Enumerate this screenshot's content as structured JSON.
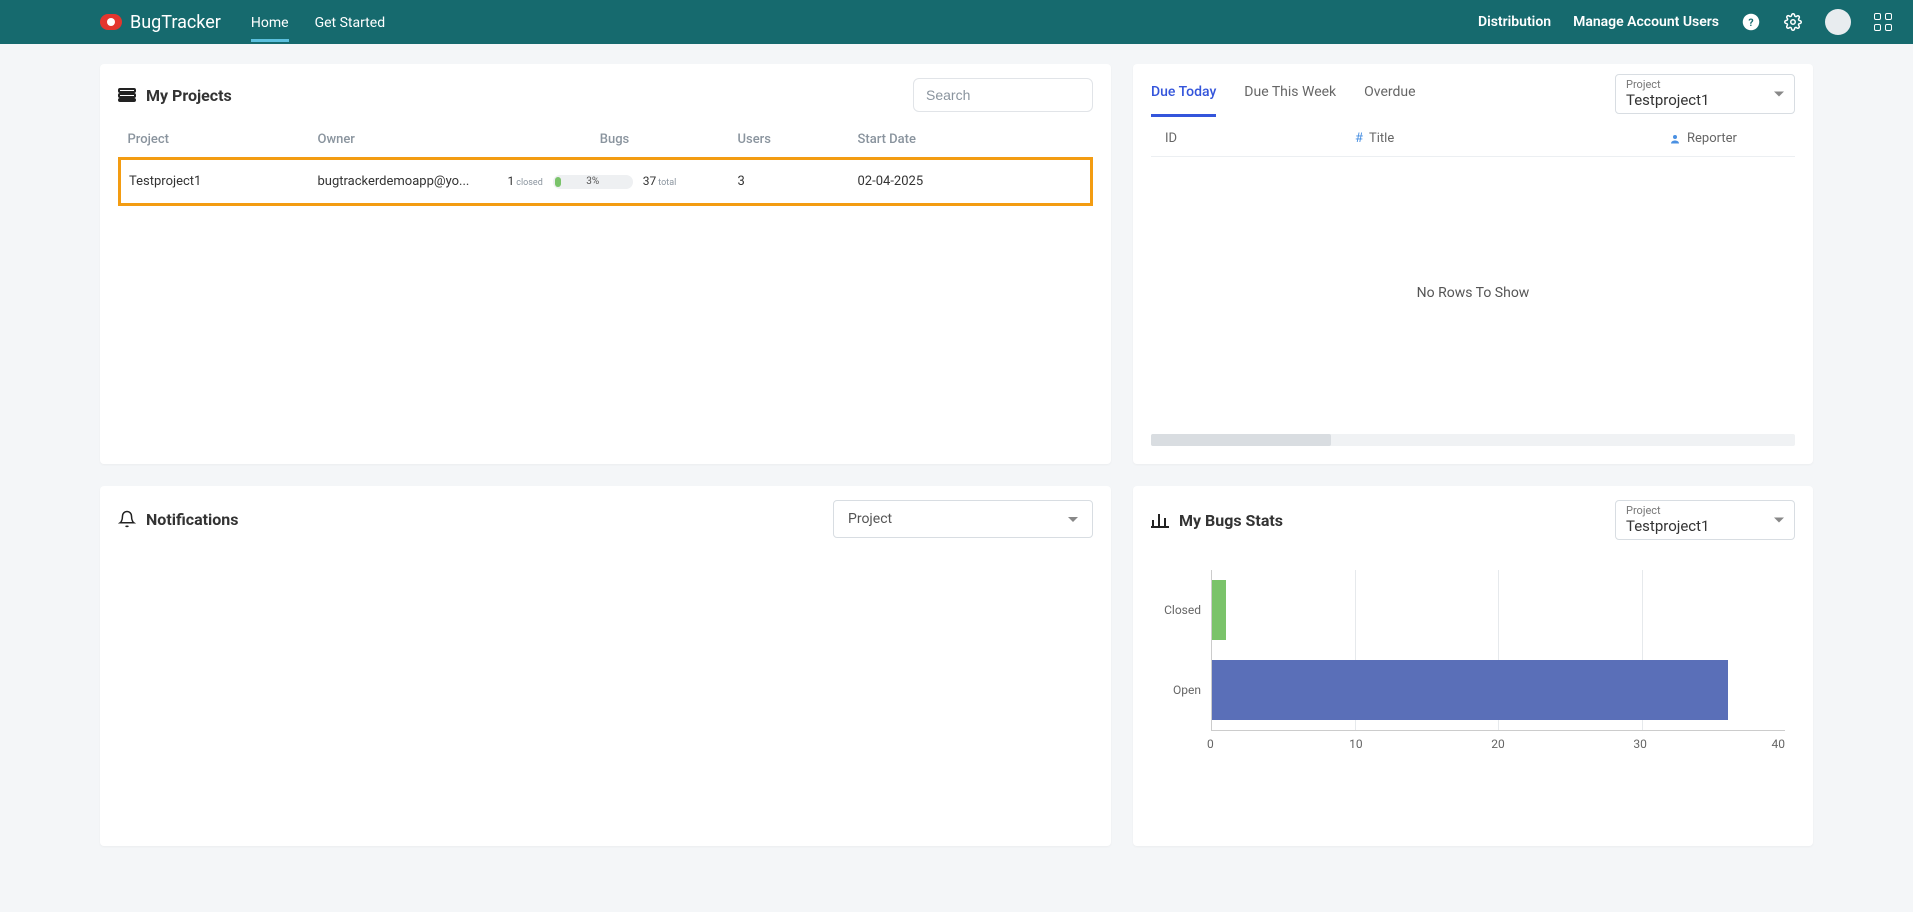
{
  "brand": "BugTracker",
  "nav": {
    "home": "Home",
    "get_started": "Get Started"
  },
  "topbar": {
    "distribution": "Distribution",
    "manage_users": "Manage Account Users"
  },
  "projects": {
    "title": "My Projects",
    "search_placeholder": "Search",
    "columns": {
      "project": "Project",
      "owner": "Owner",
      "bugs": "Bugs",
      "users": "Users",
      "start_date": "Start Date"
    },
    "row": {
      "name": "Testproject1",
      "owner": "bugtrackerdemoapp@yo...",
      "closed_count": "1",
      "closed_label": "closed",
      "percent": "3%",
      "total_count": "37",
      "total_label": "total",
      "users": "3",
      "start_date": "02-04-2025"
    }
  },
  "due": {
    "tabs": {
      "today": "Due Today",
      "week": "Due This Week",
      "overdue": "Overdue"
    },
    "project_label": "Project",
    "project_value": "Testproject1",
    "columns": {
      "id": "ID",
      "title": "Title",
      "reporter": "Reporter"
    },
    "empty": "No Rows To Show"
  },
  "notifications": {
    "title": "Notifications",
    "select_label": "Project"
  },
  "stats": {
    "title": "My Bugs Stats",
    "project_label": "Project",
    "project_value": "Testproject1"
  },
  "chart_data": {
    "type": "bar",
    "orientation": "horizontal",
    "categories": [
      "Closed",
      "Open"
    ],
    "values": [
      1,
      36
    ],
    "colors": [
      "#7ac36a",
      "#5a6fb8"
    ],
    "xlabel": "",
    "ylabel": "",
    "xlim": [
      0,
      40
    ],
    "ticks": [
      0,
      10,
      20,
      30,
      40
    ]
  }
}
